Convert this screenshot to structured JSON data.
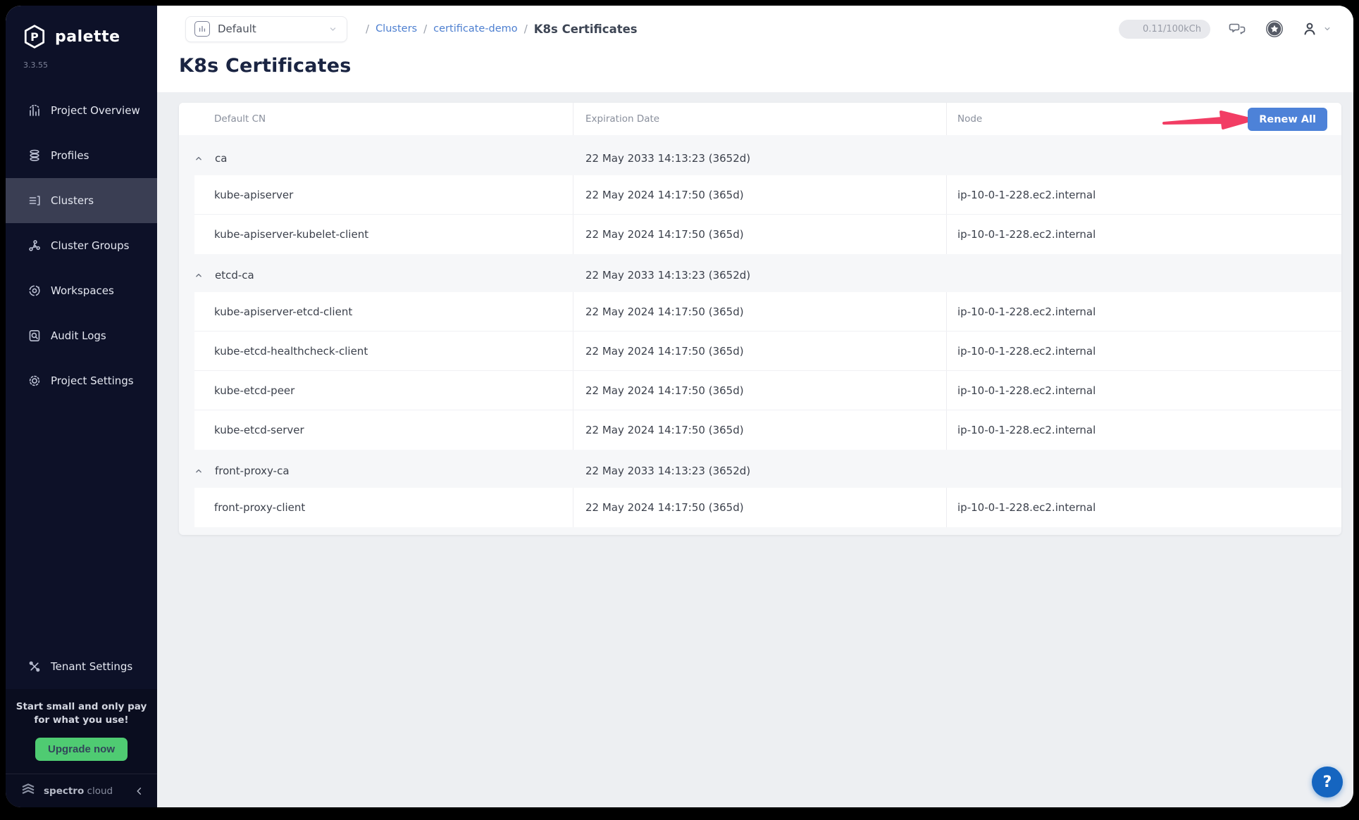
{
  "sidebar": {
    "brand": "palette",
    "version": "3.3.55",
    "items": [
      {
        "id": "project-overview",
        "label": "Project Overview",
        "icon": "bar-chart-icon",
        "active": false
      },
      {
        "id": "profiles",
        "label": "Profiles",
        "icon": "database-icon",
        "active": false
      },
      {
        "id": "clusters",
        "label": "Clusters",
        "icon": "list-icon",
        "active": true
      },
      {
        "id": "cluster-groups",
        "label": "Cluster Groups",
        "icon": "network-icon",
        "active": false
      },
      {
        "id": "workspaces",
        "label": "Workspaces",
        "icon": "orbit-icon",
        "active": false
      },
      {
        "id": "audit-logs",
        "label": "Audit Logs",
        "icon": "doc-search-icon",
        "active": false
      },
      {
        "id": "project-settings",
        "label": "Project Settings",
        "icon": "gear-icon",
        "active": false
      }
    ],
    "tenant_settings": {
      "id": "tenant-settings",
      "label": "Tenant Settings",
      "icon": "tools-icon",
      "active": false
    },
    "promo": {
      "line1": "Start small and only pay",
      "line2": "for what you use!",
      "button_label": "Upgrade now"
    },
    "footer": {
      "brand_bold": "spectro",
      "brand_light": "cloud"
    }
  },
  "topbar": {
    "project_selector": {
      "value": "Default"
    },
    "breadcrumb": [
      {
        "label": "Clusters",
        "link": true
      },
      {
        "label": "certificate-demo",
        "link": true
      },
      {
        "label": "K8s Certificates",
        "link": false
      }
    ],
    "usage_badge": "0.11/100kCh"
  },
  "page": {
    "title": "K8s Certificates"
  },
  "table": {
    "columns": [
      "Default CN",
      "Expiration Date",
      "Node"
    ],
    "renew_all_label": "Renew All",
    "groups": [
      {
        "name": "ca",
        "expiration": "22 May 2033 14:13:23 (3652d)",
        "children": [
          {
            "name": "kube-apiserver",
            "expiration": "22 May 2024 14:17:50 (365d)",
            "node": "ip-10-0-1-228.ec2.internal"
          },
          {
            "name": "kube-apiserver-kubelet-client",
            "expiration": "22 May 2024 14:17:50 (365d)",
            "node": "ip-10-0-1-228.ec2.internal"
          }
        ]
      },
      {
        "name": "etcd-ca",
        "expiration": "22 May 2033 14:13:23 (3652d)",
        "children": [
          {
            "name": "kube-apiserver-etcd-client",
            "expiration": "22 May 2024 14:17:50 (365d)",
            "node": "ip-10-0-1-228.ec2.internal"
          },
          {
            "name": "kube-etcd-healthcheck-client",
            "expiration": "22 May 2024 14:17:50 (365d)",
            "node": "ip-10-0-1-228.ec2.internal"
          },
          {
            "name": "kube-etcd-peer",
            "expiration": "22 May 2024 14:17:50 (365d)",
            "node": "ip-10-0-1-228.ec2.internal"
          },
          {
            "name": "kube-etcd-server",
            "expiration": "22 May 2024 14:17:50 (365d)",
            "node": "ip-10-0-1-228.ec2.internal"
          }
        ]
      },
      {
        "name": "front-proxy-ca",
        "expiration": "22 May 2033 14:13:23 (3652d)",
        "children": [
          {
            "name": "front-proxy-client",
            "expiration": "22 May 2024 14:17:50 (365d)",
            "node": "ip-10-0-1-228.ec2.internal"
          }
        ]
      }
    ]
  },
  "help_button_label": "?",
  "colors": {
    "sidebar_bg": "#0d1128",
    "active_item_bg": "#3a3e53",
    "accent_blue": "#4d82d8",
    "link_blue": "#4d7fd0",
    "annotation_pink": "#f23d64",
    "upgrade_green": "#4fcb72",
    "help_blue": "#1565c0"
  }
}
